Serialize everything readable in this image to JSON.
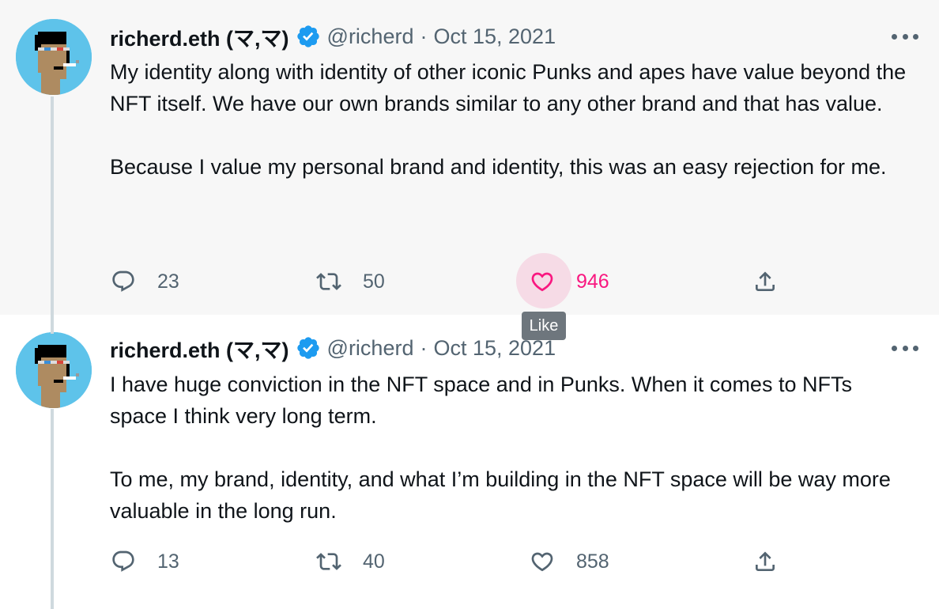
{
  "tweets": [
    {
      "name": "richerd.eth (マ,マ)",
      "handle": "@richerd",
      "separator": "·",
      "date": "Oct 15, 2021",
      "paragraphs": [
        "My identity along with identity of other iconic Punks and apes have value beyond the NFT itself. We have our own brands similar to any other brand and that has value.",
        "Because I value my personal brand and identity, this was an easy rejection for me."
      ],
      "replies": "23",
      "retweets": "50",
      "likes": "946",
      "like_hovered": true
    },
    {
      "name": "richerd.eth (マ,マ)",
      "handle": "@richerd",
      "separator": "·",
      "date": "Oct 15, 2021",
      "paragraphs": [
        "I have huge conviction in the NFT space and in Punks. When it comes to NFTs space I think very long term.",
        "To me, my brand, identity, and what I’m building in the NFT space will be way more valuable in the long run."
      ],
      "replies": "13",
      "retweets": "40",
      "likes": "858",
      "like_hovered": false
    }
  ],
  "tooltip": {
    "label": "Like"
  },
  "icons": {
    "avatar": "cryptopunk-avatar-icon",
    "verified": "verified-badge-icon",
    "more": "more-options-icon",
    "reply": "reply-icon",
    "retweet": "retweet-icon",
    "like": "heart-icon",
    "share": "share-icon"
  },
  "colors": {
    "text": "#0f1419",
    "secondary": "#536471",
    "verified": "#1d9bf0",
    "like": "#f91880",
    "hover_background": "#f7f7f7",
    "avatar_background": "#5ec3ea"
  }
}
